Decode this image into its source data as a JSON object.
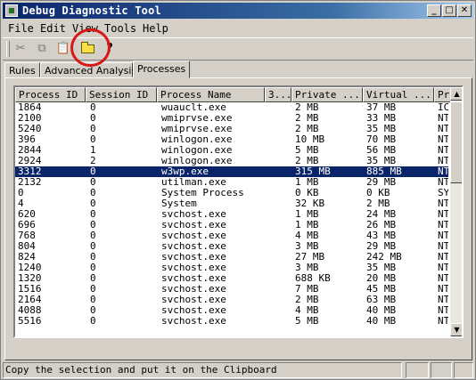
{
  "window": {
    "title": "Debug Diagnostic Tool",
    "minimize": "_",
    "maximize": "□",
    "close": "✕"
  },
  "menu": [
    "File",
    "Edit",
    "View",
    "Tools",
    "Help"
  ],
  "toolbar": {
    "cut_icon": "✂",
    "copy_icon": "⧉",
    "paste_icon": "📋",
    "help_icon": "?",
    "highlight_color": "#d81818"
  },
  "tabs": [
    {
      "label": "Rules"
    },
    {
      "label": "Advanced Analysis"
    },
    {
      "label": "Processes",
      "active": true
    }
  ],
  "list": {
    "columns": [
      "Process ID",
      "Session ID",
      "Process Name",
      "3...",
      "Private ...",
      "Virtual ...",
      "Pr"
    ],
    "selected_color": "#0a246a",
    "rows": [
      [
        "1864",
        "0",
        "wuauclt.exe",
        "",
        "2 MB",
        "37 MB",
        "IC"
      ],
      [
        "2100",
        "0",
        "wmiprvse.exe",
        "",
        "2 MB",
        "33 MB",
        "NT"
      ],
      [
        "5240",
        "0",
        "wmiprvse.exe",
        "",
        "2 MB",
        "35 MB",
        "NT"
      ],
      [
        "396",
        "0",
        "winlogon.exe",
        "",
        "10 MB",
        "70 MB",
        "NT"
      ],
      [
        "2844",
        "1",
        "winlogon.exe",
        "",
        "5 MB",
        "56 MB",
        "NT"
      ],
      [
        "2924",
        "2",
        "winlogon.exe",
        "",
        "2 MB",
        "35 MB",
        "NT"
      ],
      [
        "3312",
        "0",
        "w3wp.exe",
        "",
        "315 MB",
        "885 MB",
        "NT"
      ],
      [
        "2132",
        "0",
        "utilman.exe",
        "",
        "1 MB",
        "29 MB",
        "NT"
      ],
      [
        "0",
        "0",
        "System Process",
        "",
        "0 KB",
        "0 KB",
        "SY"
      ],
      [
        "4",
        "0",
        "System",
        "",
        "32 KB",
        "2 MB",
        "NT"
      ],
      [
        "620",
        "0",
        "svchost.exe",
        "",
        "1 MB",
        "24 MB",
        "NT"
      ],
      [
        "696",
        "0",
        "svchost.exe",
        "",
        "1 MB",
        "26 MB",
        "NT"
      ],
      [
        "768",
        "0",
        "svchost.exe",
        "",
        "4 MB",
        "43 MB",
        "NT"
      ],
      [
        "804",
        "0",
        "svchost.exe",
        "",
        "3 MB",
        "29 MB",
        "NT"
      ],
      [
        "824",
        "0",
        "svchost.exe",
        "",
        "27 MB",
        "242 MB",
        "NT"
      ],
      [
        "1240",
        "0",
        "svchost.exe",
        "",
        "3 MB",
        "35 MB",
        "NT"
      ],
      [
        "1320",
        "0",
        "svchost.exe",
        "",
        "688 KB",
        "20 MB",
        "NT"
      ],
      [
        "1516",
        "0",
        "svchost.exe",
        "",
        "7 MB",
        "45 MB",
        "NT"
      ],
      [
        "2164",
        "0",
        "svchost.exe",
        "",
        "2 MB",
        "63 MB",
        "NT"
      ],
      [
        "4088",
        "0",
        "svchost.exe",
        "",
        "4 MB",
        "40 MB",
        "NT"
      ],
      [
        "5516",
        "0",
        "svchost.exe",
        "",
        "5 MB",
        "40 MB",
        "NT"
      ]
    ]
  },
  "scrollbar": {
    "up": "▲",
    "down": "▼"
  },
  "status": {
    "text": "Copy the selection and put it on the Clipboard"
  }
}
